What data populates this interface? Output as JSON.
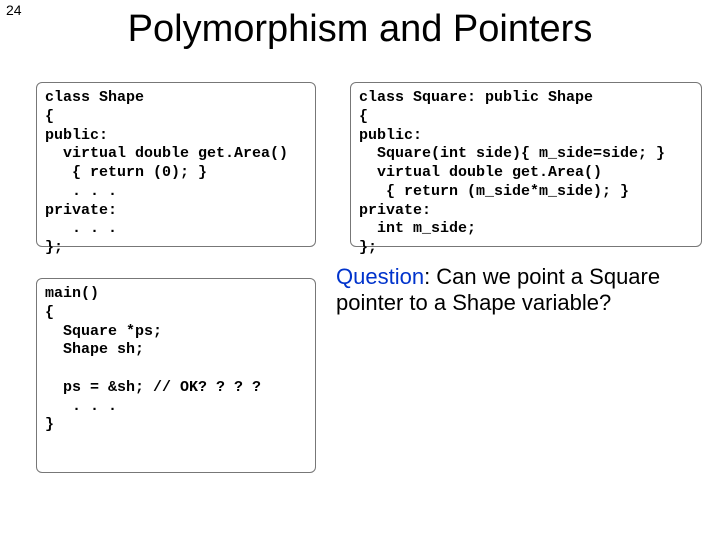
{
  "page_number": "24",
  "title": "Polymorphism and Pointers",
  "code": {
    "shape": "class Shape\n{\npublic:\n  virtual double get.Area()\n   { return (0); }\n   . . .\nprivate:\n   . . .\n};",
    "square": "class Square: public Shape\n{\npublic:\n  Square(int side){ m_side=side; }\n  virtual double get.Area()\n   { return (m_side*m_side); }\nprivate:\n  int m_side;\n};",
    "main": "main()\n{\n  Square *ps;\n  Shape sh;\n\n  ps = &sh; // OK? ? ? ?\n   . . .\n}"
  },
  "question": {
    "label": "Question",
    "text": ": Can we point a Square pointer to a Shape variable?"
  }
}
